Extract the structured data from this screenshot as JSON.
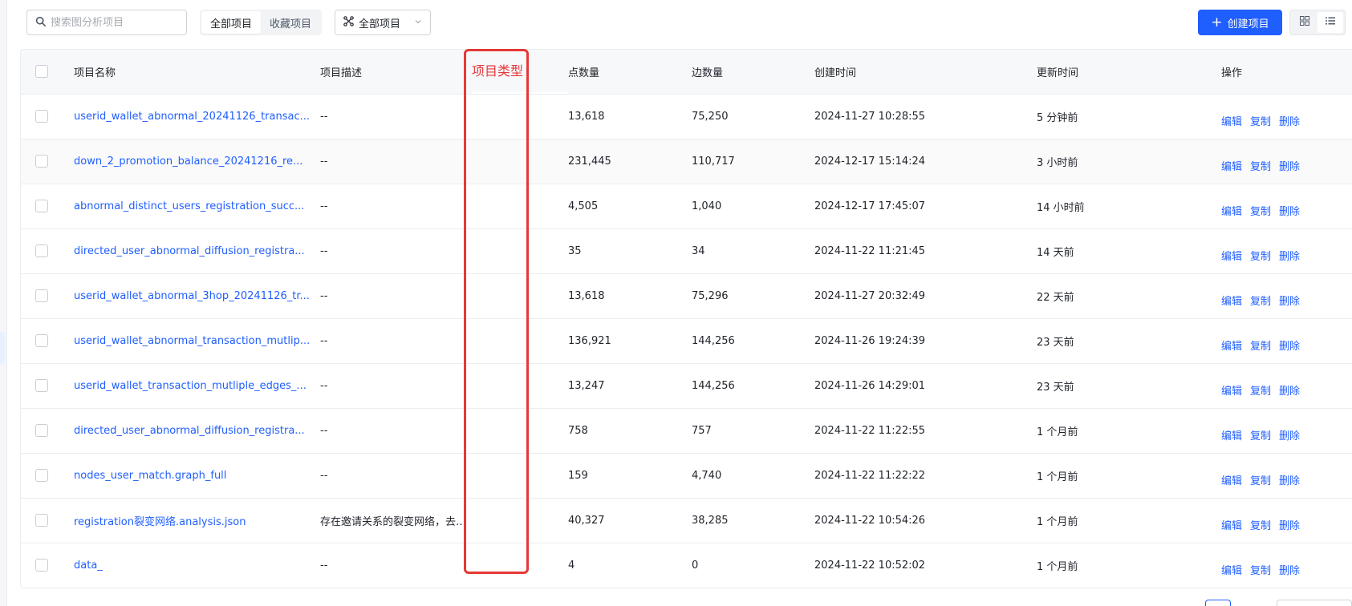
{
  "toolbar": {
    "search_placeholder": "搜索图分析项目",
    "search_icon": "search-icon",
    "segments": [
      "全部项目",
      "收藏项目"
    ],
    "active_segment": "全部项目",
    "filter_select_value": "全部项目",
    "filter_icon": "graph-nodes-icon",
    "create_button_label": "创建项目",
    "view_modes": [
      "grid-view-icon",
      "list-view-icon"
    ]
  },
  "table": {
    "columns": {
      "name": "项目名称",
      "desc": "项目描述",
      "type": "项目类型",
      "nodes": "点数量",
      "edges": "边数量",
      "created": "创建时间",
      "updated": "更新时间",
      "ops": "操作"
    },
    "op_labels": {
      "edit": "编辑",
      "copy": "复制",
      "delete": "删除"
    },
    "rows": [
      {
        "name": "userid_wallet_abnormal_20241126_transac...",
        "desc": "--",
        "type": "",
        "nodes": "13,618",
        "edges": "75,250",
        "created": "2024-11-27 10:28:55",
        "updated": "5 分钟前"
      },
      {
        "name": "down_2_promotion_balance_20241216_re...",
        "desc": "--",
        "type": "",
        "nodes": "231,445",
        "edges": "110,717",
        "created": "2024-12-17 15:14:24",
        "updated": "3 小时前"
      },
      {
        "name": "abnormal_distinct_users_registration_succ...",
        "desc": "--",
        "type": "",
        "nodes": "4,505",
        "edges": "1,040",
        "created": "2024-12-17 17:45:07",
        "updated": "14 小时前"
      },
      {
        "name": "directed_user_abnormal_diffusion_registra...",
        "desc": "--",
        "type": "",
        "nodes": "35",
        "edges": "34",
        "created": "2024-11-22 11:21:45",
        "updated": "14 天前"
      },
      {
        "name": "userid_wallet_abnormal_3hop_20241126_tr...",
        "desc": "--",
        "type": "",
        "nodes": "13,618",
        "edges": "75,296",
        "created": "2024-11-27 20:32:49",
        "updated": "22 天前"
      },
      {
        "name": "userid_wallet_abnormal_transaction_mutlip...",
        "desc": "--",
        "type": "",
        "nodes": "136,921",
        "edges": "144,256",
        "created": "2024-11-26 19:24:39",
        "updated": "23 天前"
      },
      {
        "name": "userid_wallet_transaction_mutliple_edges_...",
        "desc": "--",
        "type": "",
        "nodes": "13,247",
        "edges": "144,256",
        "created": "2024-11-26 14:29:01",
        "updated": "23 天前"
      },
      {
        "name": "directed_user_abnormal_diffusion_registra...",
        "desc": "--",
        "type": "",
        "nodes": "758",
        "edges": "757",
        "created": "2024-11-22 11:22:55",
        "updated": "1 个月前"
      },
      {
        "name": "nodes_user_match.graph_full",
        "desc": "--",
        "type": "",
        "nodes": "159",
        "edges": "4,740",
        "created": "2024-11-22 11:22:22",
        "updated": "1 个月前"
      },
      {
        "name": "registration裂变网络.analysis.json",
        "desc": "存在邀请关系的裂变网络，去掉degree为0的...",
        "type": "",
        "nodes": "40,327",
        "edges": "38,285",
        "created": "2024-11-22 10:54:26",
        "updated": "1 个月前"
      },
      {
        "name": "data_",
        "desc": "--",
        "type": "",
        "nodes": "4",
        "edges": "0",
        "created": "2024-11-22 10:52:02",
        "updated": "1 个月前"
      }
    ]
  },
  "colors": {
    "primary": "#1f5eff",
    "highlight": "#e53935"
  }
}
